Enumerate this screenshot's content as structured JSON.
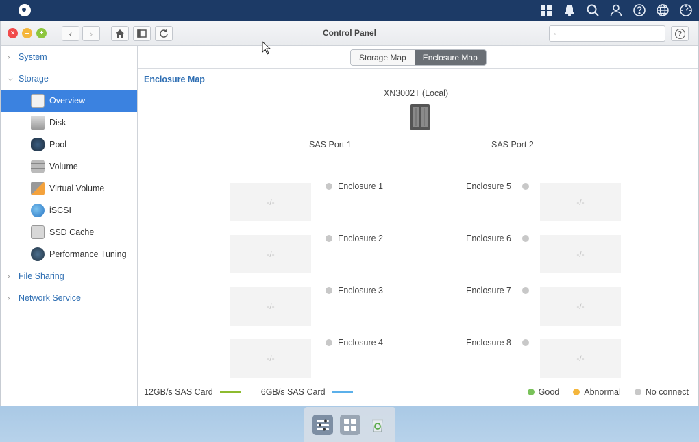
{
  "window": {
    "title": "Control Panel"
  },
  "search": {
    "placeholder": ""
  },
  "sidebar": {
    "system": "System",
    "storage": "Storage",
    "items": [
      {
        "label": "Overview"
      },
      {
        "label": "Disk"
      },
      {
        "label": "Pool"
      },
      {
        "label": "Volume"
      },
      {
        "label": "Virtual Volume"
      },
      {
        "label": "iSCSI"
      },
      {
        "label": "SSD Cache"
      },
      {
        "label": "Performance Tuning"
      }
    ],
    "file_sharing": "File Sharing",
    "network_service": "Network Service"
  },
  "tabs": {
    "storage_map": "Storage Map",
    "enclosure_map": "Enclosure Map"
  },
  "main": {
    "section_title": "Enclosure Map",
    "device_name": "XN3002T (Local)",
    "port1": "SAS Port 1",
    "port2": "SAS Port 2",
    "empty_slot": "-/-",
    "enclosures_left": [
      "Enclosure 1",
      "Enclosure 2",
      "Enclosure 3",
      "Enclosure 4"
    ],
    "enclosures_right": [
      "Enclosure 5",
      "Enclosure 6",
      "Enclosure 7",
      "Enclosure 8"
    ]
  },
  "legend": {
    "sas12": "12GB/s SAS Card",
    "sas6": "6GB/s SAS Card",
    "good": "Good",
    "abnormal": "Abnormal",
    "no_connect": "No connect"
  },
  "colors": {
    "accent": "#3b82e0",
    "sas12_line": "#8dbb2f",
    "sas6_line": "#5bb0ea",
    "good": "#79c25a",
    "abnormal": "#f4b63c",
    "no_connect": "#c8c8c8"
  }
}
